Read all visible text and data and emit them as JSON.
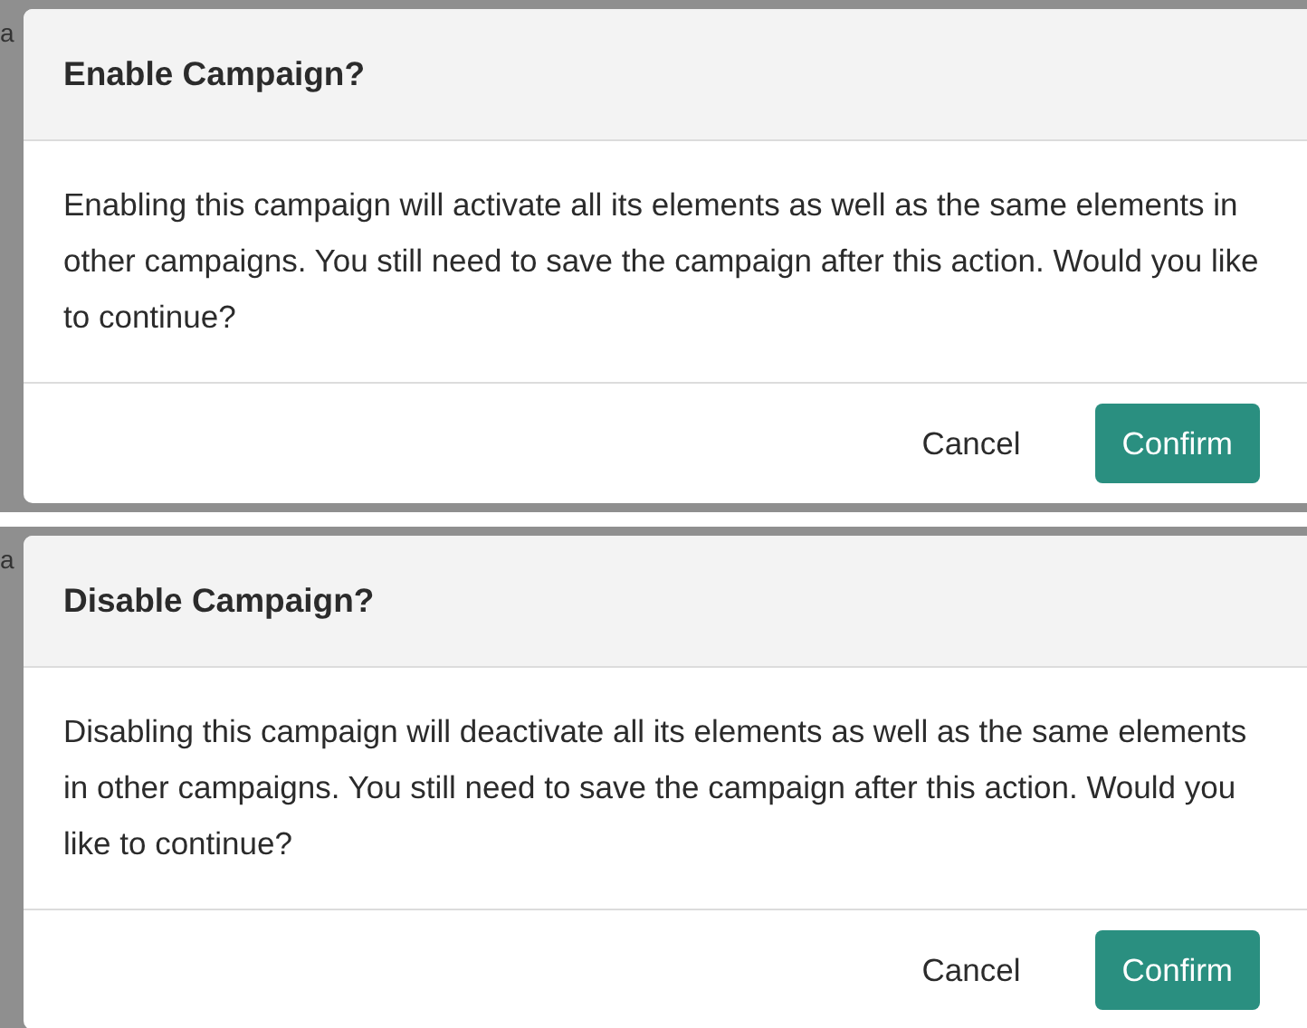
{
  "dialogs": [
    {
      "backdrop_fragment": "a",
      "title": "Enable Campaign?",
      "message": "Enabling this campaign will activate all its elements as well as the same elements in other campaigns. You still need to save the campaign after this action. Would you like to continue?",
      "buttons": [
        {
          "label": "Cancel",
          "kind": "text"
        },
        {
          "label": "Confirm",
          "kind": "primary"
        }
      ]
    },
    {
      "backdrop_fragment": "a",
      "title": "Disable Campaign?",
      "message": "Disabling this campaign will deactivate all its elements as well as the same elements in other campaigns. You still need to save the campaign after this action. Would you like to continue?",
      "buttons": [
        {
          "label": "Cancel",
          "kind": "text"
        },
        {
          "label": "Confirm",
          "kind": "primary"
        }
      ]
    }
  ]
}
